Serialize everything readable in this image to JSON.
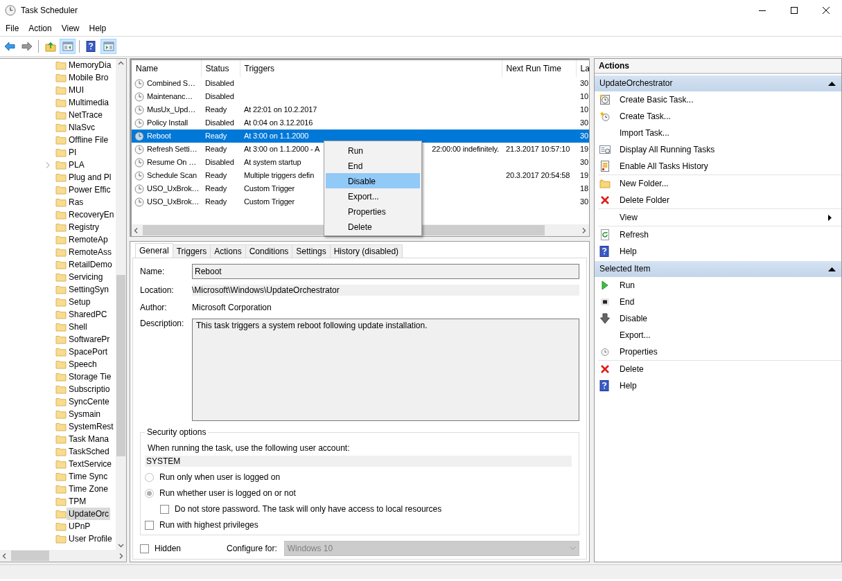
{
  "window": {
    "title": "Task Scheduler"
  },
  "menu": [
    "File",
    "Action",
    "View",
    "Help"
  ],
  "toolbar": [
    [
      {
        "kind": "back",
        "pressed": false
      },
      {
        "kind": "forward",
        "pressed": false
      }
    ],
    [
      {
        "kind": "up-folder",
        "pressed": false
      },
      {
        "kind": "console-tree",
        "pressed": true
      }
    ],
    [
      {
        "kind": "help",
        "pressed": false
      },
      {
        "kind": "action-pane",
        "pressed": true
      }
    ]
  ],
  "tree": {
    "items": [
      {
        "label": "MemoryDia",
        "expandable": false,
        "selected": false
      },
      {
        "label": "Mobile Bro",
        "expandable": false,
        "selected": false
      },
      {
        "label": "MUI",
        "expandable": false,
        "selected": false
      },
      {
        "label": "Multimedia",
        "expandable": false,
        "selected": false
      },
      {
        "label": "NetTrace",
        "expandable": false,
        "selected": false
      },
      {
        "label": "NlaSvc",
        "expandable": false,
        "selected": false
      },
      {
        "label": "Offline File",
        "expandable": false,
        "selected": false
      },
      {
        "label": "PI",
        "expandable": false,
        "selected": false
      },
      {
        "label": "PLA",
        "expandable": true,
        "selected": false
      },
      {
        "label": "Plug and Pl",
        "expandable": false,
        "selected": false
      },
      {
        "label": "Power Effic",
        "expandable": false,
        "selected": false
      },
      {
        "label": "Ras",
        "expandable": false,
        "selected": false
      },
      {
        "label": "RecoveryEn",
        "expandable": false,
        "selected": false
      },
      {
        "label": "Registry",
        "expandable": false,
        "selected": false
      },
      {
        "label": "RemoteAp",
        "expandable": false,
        "selected": false
      },
      {
        "label": "RemoteAss",
        "expandable": false,
        "selected": false
      },
      {
        "label": "RetailDemo",
        "expandable": false,
        "selected": false
      },
      {
        "label": "Servicing",
        "expandable": false,
        "selected": false
      },
      {
        "label": "SettingSyn",
        "expandable": false,
        "selected": false
      },
      {
        "label": "Setup",
        "expandable": false,
        "selected": false
      },
      {
        "label": "SharedPC",
        "expandable": false,
        "selected": false
      },
      {
        "label": "Shell",
        "expandable": false,
        "selected": false
      },
      {
        "label": "SoftwarePr",
        "expandable": false,
        "selected": false
      },
      {
        "label": "SpacePort",
        "expandable": false,
        "selected": false
      },
      {
        "label": "Speech",
        "expandable": false,
        "selected": false
      },
      {
        "label": "Storage Tie",
        "expandable": false,
        "selected": false
      },
      {
        "label": "Subscriptio",
        "expandable": false,
        "selected": false
      },
      {
        "label": "SyncCente",
        "expandable": false,
        "selected": false
      },
      {
        "label": "Sysmain",
        "expandable": false,
        "selected": false
      },
      {
        "label": "SystemRest",
        "expandable": false,
        "selected": false
      },
      {
        "label": "Task Mana",
        "expandable": false,
        "selected": false
      },
      {
        "label": "TaskSched",
        "expandable": false,
        "selected": false
      },
      {
        "label": "TextService",
        "expandable": false,
        "selected": false
      },
      {
        "label": "Time Sync",
        "expandable": false,
        "selected": false
      },
      {
        "label": "Time Zone",
        "expandable": false,
        "selected": false
      },
      {
        "label": "TPM",
        "expandable": false,
        "selected": false
      },
      {
        "label": "UpdateOrc",
        "expandable": false,
        "selected": true
      },
      {
        "label": "UPnP",
        "expandable": false,
        "selected": false
      },
      {
        "label": "User Profile",
        "expandable": false,
        "selected": false
      }
    ]
  },
  "task_list": {
    "columns": [
      "Name",
      "Status",
      "Triggers",
      "Next Run Time",
      "La"
    ],
    "rows": [
      {
        "name": "Combined S…",
        "status": "Disabled",
        "column_5": "30",
        "selected": false
      },
      {
        "name": "Maintenanc…",
        "status": "Disabled",
        "column_5": "10",
        "selected": false
      },
      {
        "name": "MusUx_Upd…",
        "status": "Ready",
        "triggers": "At 22:01 on 10.2.2017",
        "column_5": "10",
        "selected": false
      },
      {
        "name": "Policy Install",
        "status": "Disabled",
        "triggers": "At 0:04 on 3.12.2016",
        "column_5": "30",
        "selected": false
      },
      {
        "name": "Reboot",
        "status": "Ready",
        "triggers": "At 3:00 on 1.1.2000",
        "column_5": "30",
        "selected": true
      },
      {
        "name": "Refresh Setti…",
        "status": "Ready",
        "triggers": "At 3:00 on 1.1.2000 - A",
        "triggers_tail": "22:00:00 indefinitely.",
        "next_run": "21.3.2017 10:57:10",
        "column_5": "19",
        "selected": false
      },
      {
        "name": "Resume On …",
        "status": "Disabled",
        "triggers": "At system startup",
        "column_5": "30",
        "selected": false
      },
      {
        "name": "Schedule Scan",
        "status": "Ready",
        "triggers": "Multiple triggers defin",
        "next_run": "20.3.2017 20:54:58",
        "column_5": "19",
        "selected": false
      },
      {
        "name": "USO_UxBrok…",
        "status": "Ready",
        "triggers": "Custom Trigger",
        "column_5": "18",
        "selected": false
      },
      {
        "name": "USO_UxBrok…",
        "status": "Ready",
        "triggers": "Custom Trigger",
        "column_5": "30",
        "selected": false
      }
    ]
  },
  "context_menu": {
    "items": [
      {
        "label": "Run",
        "selected": false
      },
      {
        "label": "End",
        "selected": false
      },
      {
        "label": "Disable",
        "selected": true
      },
      {
        "label": "Export...",
        "selected": false
      },
      {
        "label": "Properties",
        "selected": false
      },
      {
        "label": "Delete",
        "selected": false
      }
    ]
  },
  "details": {
    "tabs": [
      {
        "label": "General",
        "selected": true
      },
      {
        "label": "Triggers",
        "selected": false
      },
      {
        "label": "Actions",
        "selected": false
      },
      {
        "label": "Conditions",
        "selected": false
      },
      {
        "label": "Settings",
        "selected": false
      },
      {
        "label": "History (disabled)",
        "selected": false
      }
    ],
    "name_label": "Name:",
    "name": "Reboot",
    "location_label": "Location:",
    "location": "\\Microsoft\\Windows\\UpdateOrchestrator",
    "author_label": "Author:",
    "author": "Microsoft Corporation",
    "description_label": "Description:",
    "description": "This task triggers a system reboot following update installation.",
    "security": {
      "legend": "Security options",
      "account_prompt": "When running the task, use the following user account:",
      "account": "SYSTEM",
      "run_options": [
        {
          "label": "Run only when user is logged on",
          "selected": false
        },
        {
          "label": "Run whether user is logged on or not",
          "selected": true
        }
      ],
      "do_not_store": {
        "label": "Do not store password.  The task will only have access to local resources",
        "checked": false
      },
      "highest_privileges": {
        "label": "Run with highest privileges",
        "checked": false
      }
    },
    "hidden": {
      "label": "Hidden",
      "checked": false
    },
    "configure_label": "Configure for:",
    "configure_value": "Windows 10"
  },
  "actions_pane": {
    "title": "Actions",
    "sections": [
      {
        "title": "UpdateOrchestrator",
        "expanded": true,
        "groups": [
          [
            {
              "label": "Create Basic Task...",
              "kind": "basic-task",
              "submenu": false
            },
            {
              "label": "Create Task...",
              "kind": "new-task",
              "submenu": false
            },
            {
              "label": "Import Task...",
              "kind": "none",
              "submenu": false
            },
            {
              "label": "Display All Running Tasks",
              "kind": "running-tasks",
              "submenu": false
            },
            {
              "label": "Enable All Tasks History",
              "kind": "history",
              "submenu": false
            }
          ],
          [
            {
              "label": "New Folder...",
              "kind": "new-folder",
              "submenu": false
            },
            {
              "label": "Delete Folder",
              "kind": "delete",
              "submenu": false
            }
          ],
          [
            {
              "label": "View",
              "kind": "none",
              "submenu": true
            }
          ],
          [
            {
              "label": "Refresh",
              "kind": "refresh",
              "submenu": false
            },
            {
              "label": "Help",
              "kind": "help",
              "submenu": false
            }
          ]
        ]
      },
      {
        "title": "Selected Item",
        "expanded": true,
        "groups": [
          [
            {
              "label": "Run",
              "kind": "run",
              "submenu": false
            },
            {
              "label": "End",
              "kind": "end",
              "submenu": false
            },
            {
              "label": "Disable",
              "kind": "disable",
              "submenu": false
            },
            {
              "label": "Export...",
              "kind": "none",
              "submenu": false
            },
            {
              "label": "Properties",
              "kind": "properties",
              "submenu": false
            }
          ],
          [
            {
              "label": "Delete",
              "kind": "delete",
              "submenu": false
            },
            {
              "label": "Help",
              "kind": "help",
              "submenu": false
            }
          ]
        ]
      }
    ]
  }
}
